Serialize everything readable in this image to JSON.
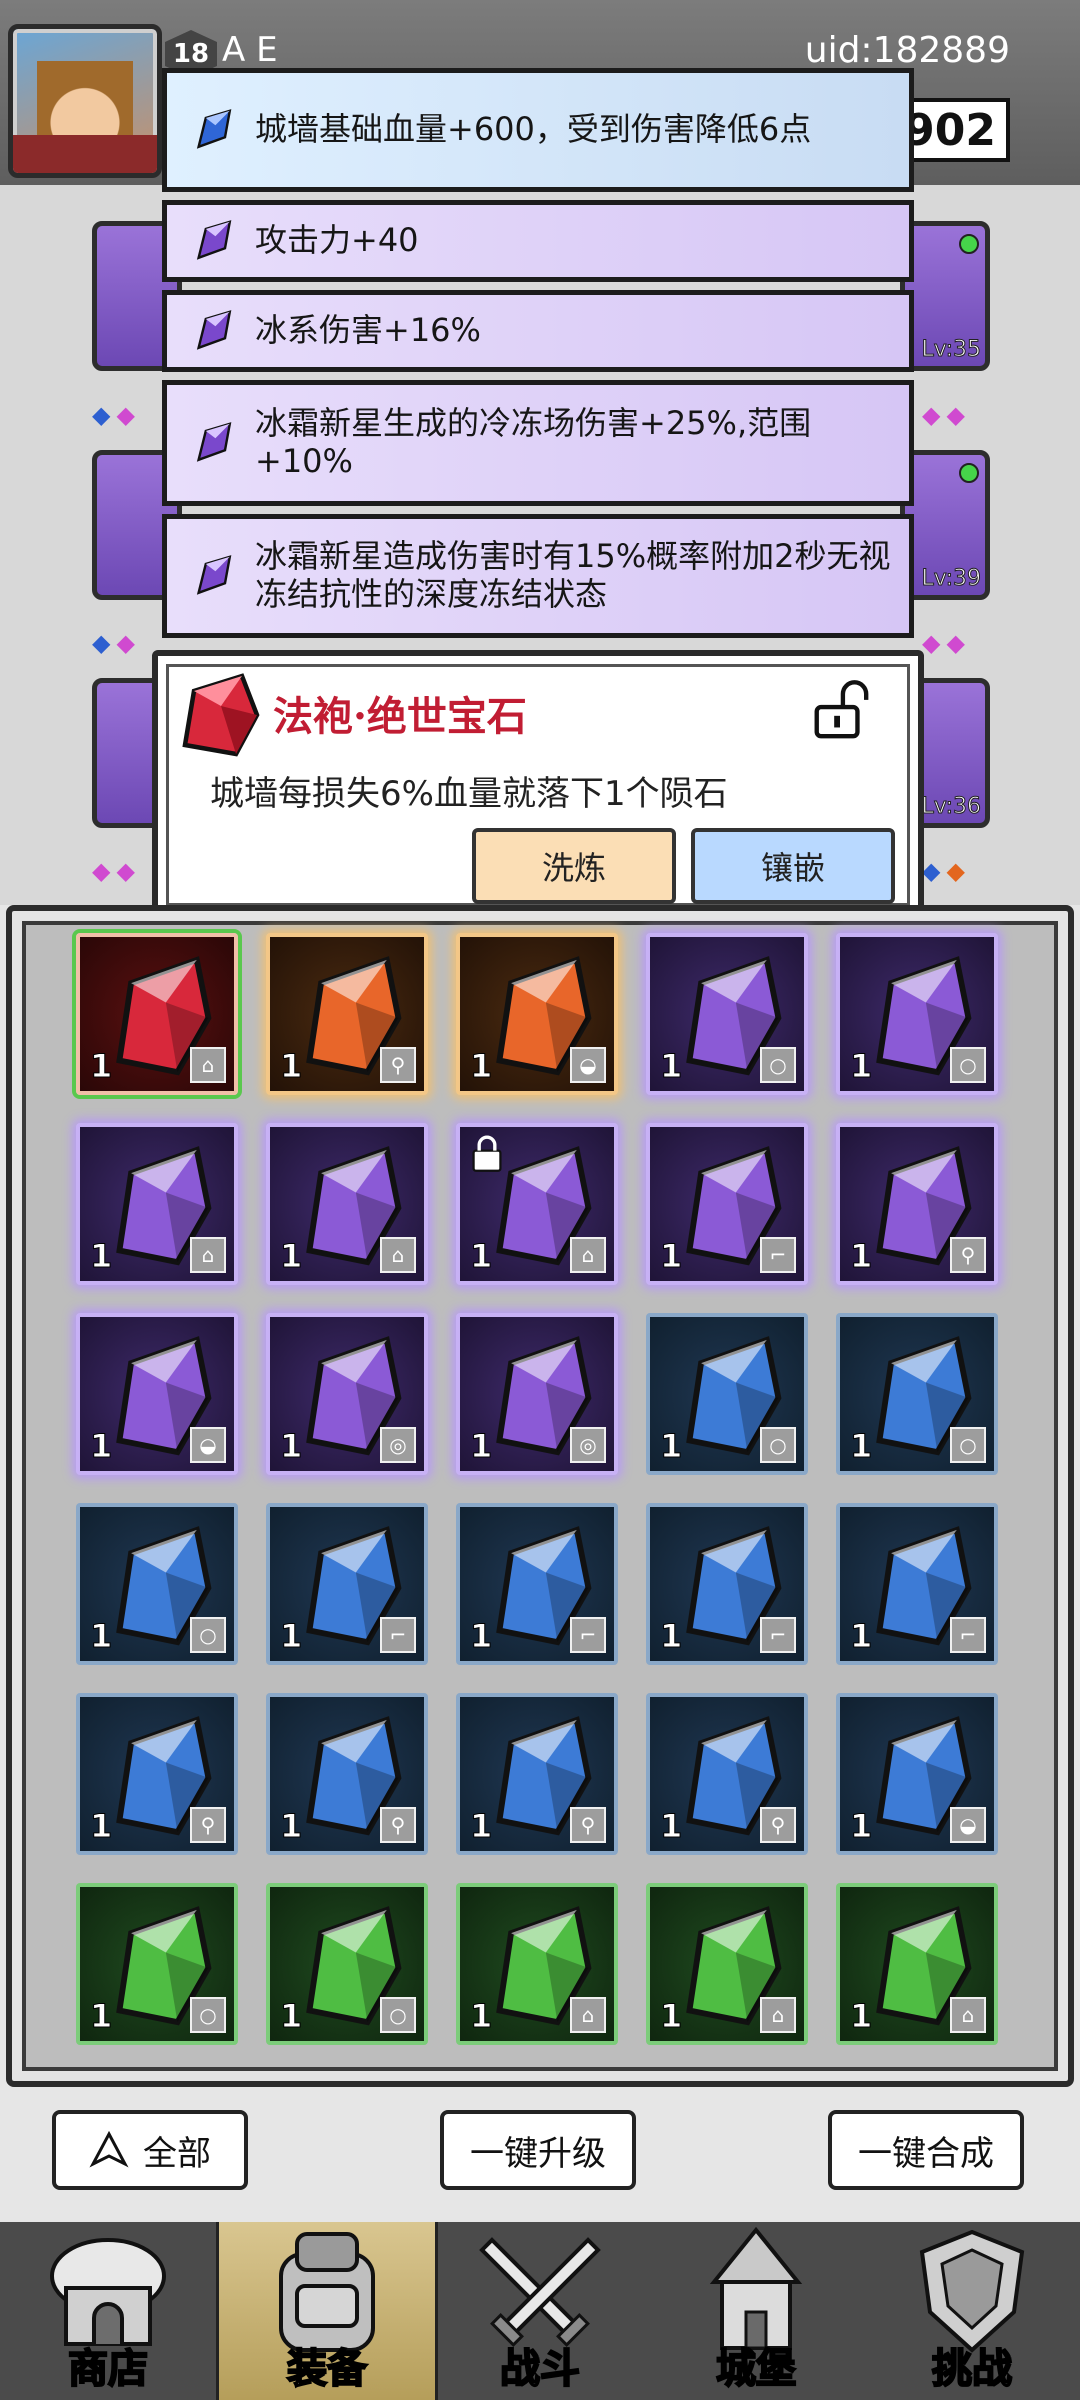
{
  "header": {
    "level": "18",
    "player_name": "A  E",
    "uid": "uid:182889",
    "coins": "902"
  },
  "equipment_levels": [
    "Lv:35",
    "Lv:39",
    "Lv:36"
  ],
  "stat_lines": [
    {
      "text": "城墙基础血量+600，受到伤害降低6点",
      "gem_color": "blue"
    },
    {
      "text": "攻击力+40",
      "gem_color": "purple"
    },
    {
      "text": "冰系伤害+16%",
      "gem_color": "purple"
    },
    {
      "text": "冰霜新星生成的冷冻场伤害+25%,范围+10%",
      "gem_color": "purple"
    },
    {
      "text": "冰霜新星造成伤害时有15%概率附加2秒无视冻结抗性的深度冻结状态",
      "gem_color": "purple"
    }
  ],
  "gem_detail": {
    "title": "法袍·绝世宝石",
    "description": "城墙每损失6%血量就落下1个陨石",
    "refine_label": "洗炼",
    "inlay_label": "镶嵌",
    "icon": "red-gem-icon",
    "lock_state": "unlocked-padlock-icon"
  },
  "inventory": [
    {
      "color": "red",
      "count": "1",
      "slot": "robe"
    },
    {
      "color": "orange",
      "count": "1",
      "slot": "staff"
    },
    {
      "color": "orange",
      "count": "1",
      "slot": "hat"
    },
    {
      "color": "purple",
      "count": "1",
      "slot": "ring"
    },
    {
      "color": "purple",
      "count": "1",
      "slot": "ring"
    },
    {
      "color": "purple",
      "count": "1",
      "slot": "robe"
    },
    {
      "color": "purple",
      "count": "1",
      "slot": "robe"
    },
    {
      "color": "purple",
      "count": "1",
      "slot": "robe",
      "locked": true
    },
    {
      "color": "purple",
      "count": "1",
      "slot": "boots"
    },
    {
      "color": "purple",
      "count": "1",
      "slot": "staff"
    },
    {
      "color": "purple",
      "count": "1",
      "slot": "hat"
    },
    {
      "color": "purple",
      "count": "1",
      "slot": "amulet"
    },
    {
      "color": "purple",
      "count": "1",
      "slot": "amulet"
    },
    {
      "color": "blue",
      "count": "1",
      "slot": "ring"
    },
    {
      "color": "blue",
      "count": "1",
      "slot": "ring"
    },
    {
      "color": "blue",
      "count": "1",
      "slot": "ring"
    },
    {
      "color": "blue",
      "count": "1",
      "slot": "boots"
    },
    {
      "color": "blue",
      "count": "1",
      "slot": "boots"
    },
    {
      "color": "blue",
      "count": "1",
      "slot": "boots"
    },
    {
      "color": "blue",
      "count": "1",
      "slot": "boots"
    },
    {
      "color": "blue",
      "count": "1",
      "slot": "staff"
    },
    {
      "color": "blue",
      "count": "1",
      "slot": "staff"
    },
    {
      "color": "blue",
      "count": "1",
      "slot": "staff"
    },
    {
      "color": "blue",
      "count": "1",
      "slot": "staff"
    },
    {
      "color": "blue",
      "count": "1",
      "slot": "hat"
    },
    {
      "color": "green",
      "count": "1",
      "slot": "ring"
    },
    {
      "color": "green",
      "count": "1",
      "slot": "ring"
    },
    {
      "color": "green",
      "count": "1",
      "slot": "robe"
    },
    {
      "color": "green",
      "count": "1",
      "slot": "robe"
    },
    {
      "color": "green",
      "count": "1",
      "slot": "robe"
    }
  ],
  "actions": {
    "filter_label": "全部",
    "upgrade_label": "一键升级",
    "merge_label": "一键合成"
  },
  "nav": [
    {
      "label": "商店",
      "icon": "shop-hut-icon"
    },
    {
      "label": "装备",
      "icon": "backpack-icon",
      "active": true
    },
    {
      "label": "战斗",
      "icon": "crossed-swords-icon"
    },
    {
      "label": "城堡",
      "icon": "castle-tower-icon"
    },
    {
      "label": "挑战",
      "icon": "challenge-shield-icon"
    }
  ],
  "colors": {
    "red": "#d8283b",
    "orange": "#e8662a",
    "purple": "#8b5ad6",
    "blue": "#3d7bd6",
    "green": "#4fbd43"
  }
}
